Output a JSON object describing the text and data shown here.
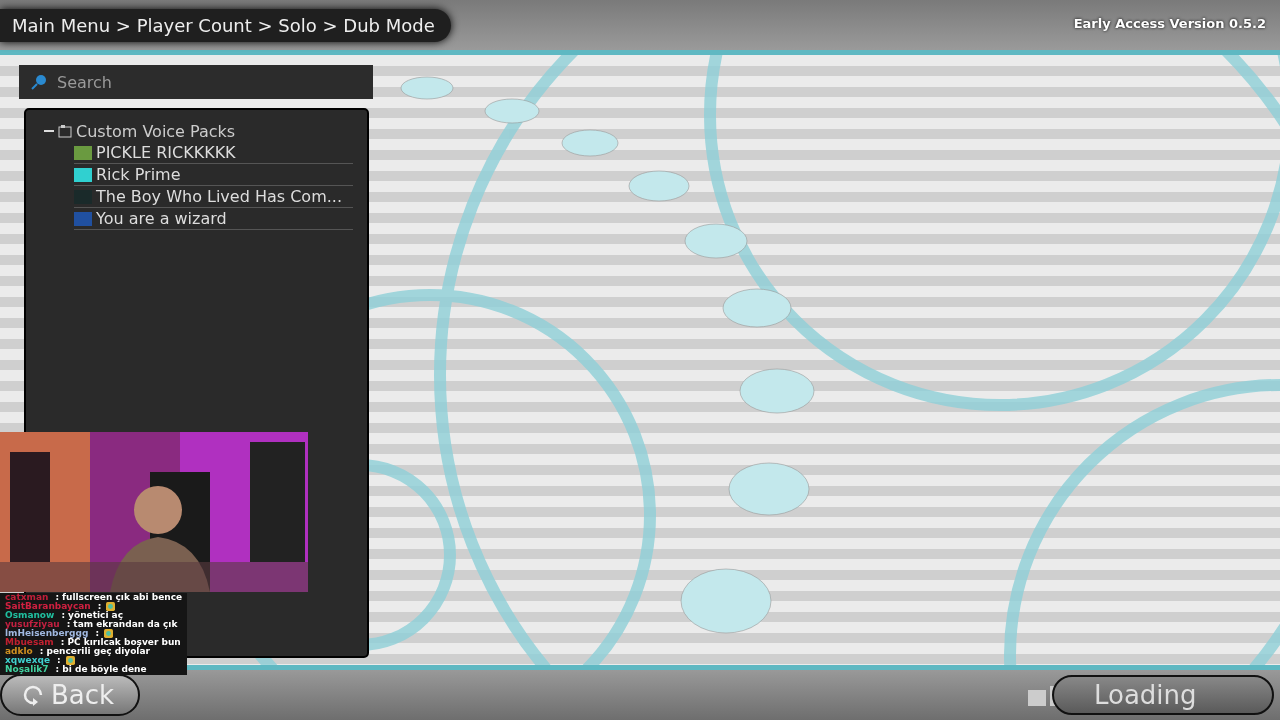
{
  "breadcrumb": "Main Menu > Player Count > Solo > Dub Mode",
  "version": "Early Access Version 0.5.2",
  "search": {
    "placeholder": "Search"
  },
  "tree": [
    {
      "label": "Custom Voice Packs",
      "expanded": true,
      "children": [
        {
          "label": "PICKLE RICKKKKK",
          "color": "#6a9a40"
        },
        {
          "label": "Rick Prime",
          "color": "#30d0d0"
        },
        {
          "label": "The Boy Who Lived Has Com...",
          "color": "#1a2a2a"
        },
        {
          "label": "You are a wizard",
          "color": "#2050a0"
        }
      ]
    }
  ],
  "chat": [
    {
      "user": "catxman",
      "color": "#c0203a",
      "message": ": fullscreen çık abi bence",
      "emote": false
    },
    {
      "user": "SaitBaranbaycan",
      "color": "#d02040",
      "message": ":",
      "emote": true
    },
    {
      "user": "Osmanow",
      "color": "#20c0a0",
      "message": ": yönetici aç",
      "emote": false
    },
    {
      "user": "yusufziyau",
      "color": "#c02040",
      "message": ": tam ekrandan da çık",
      "emote": false
    },
    {
      "user": "lmHeisenberggg",
      "color": "#a0b8e0",
      "message": ":",
      "emote": true
    },
    {
      "user": "Mbuesam",
      "color": "#c02030",
      "message": ": PC kırılcak boşver bun",
      "emote": false
    },
    {
      "user": "adklo",
      "color": "#d09020",
      "message": ": pencerili geç diyolar",
      "emote": false
    },
    {
      "user": "xqwexqe",
      "color": "#40d0d0",
      "message": ":",
      "emote": true
    },
    {
      "user": "Noşalik7",
      "color": "#40d0a0",
      "message": ": bi de böyle dene",
      "emote": false
    }
  ],
  "back_button": "Back",
  "loading": "Loading"
}
